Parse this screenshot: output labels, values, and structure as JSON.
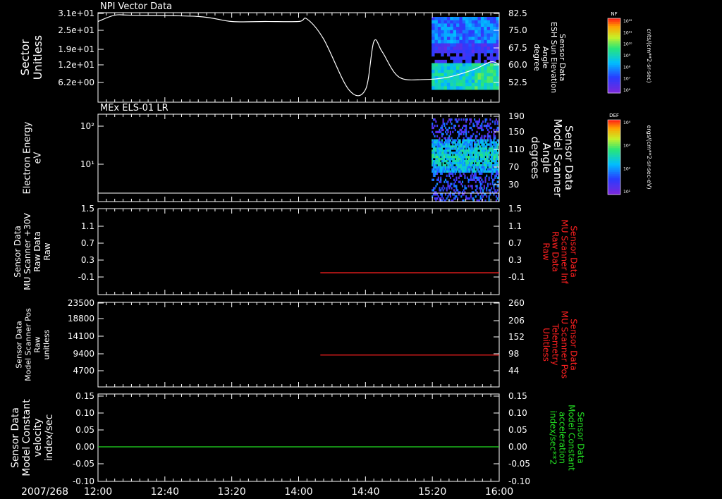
{
  "date_label": "2007/268",
  "time_ticks": [
    "12:00",
    "12:40",
    "13:20",
    "14:00",
    "14:40",
    "15:20",
    "16:00"
  ],
  "colors": {
    "white": "#ffffff",
    "red": "#ff2020",
    "green": "#22dd22"
  },
  "colorbars": [
    {
      "label": "NF",
      "units": "cnts/(cm**2-sr-sec)",
      "ticks": [
        "10¹²",
        "10¹¹",
        "10¹⁰",
        "10⁹",
        "10⁸",
        "10⁷",
        "10⁶"
      ]
    },
    {
      "label": "DEF",
      "units": "ergs/(cm**2-sr-sec-eV)",
      "ticks": [
        "10⁴",
        "10³",
        "10²",
        "10¹"
      ]
    }
  ],
  "panels": [
    {
      "title": "NPI Vector Data",
      "ylabel_left": [
        "Sector",
        "Unitless"
      ],
      "ylabel_right": [
        "Sensor Data",
        "ESH Sun Elevation",
        "Angle",
        "degree"
      ],
      "yticks_left": [
        "3.1e+01",
        "2.5e+01",
        "1.9e+01",
        "1.2e+01",
        "6.2e+00"
      ],
      "yticks_right": [
        "82.5",
        "75.0",
        "67.5",
        "60.0",
        "52.5"
      ]
    },
    {
      "title": "MEx ELS-01 LR",
      "ylabel_left": [
        "Electron Energy",
        "eV"
      ],
      "ylabel_right": [
        "Sensor Data",
        "Model Scanner",
        "Angle",
        "degrees"
      ],
      "yticks_left": [
        "10²",
        "10¹"
      ],
      "yticks_right": [
        "190",
        "150",
        "110",
        "70",
        "30"
      ]
    },
    {
      "title": "",
      "ylabel_left": [
        "Sensor Data",
        "MU Scanner +30V",
        "Raw Data",
        "Raw"
      ],
      "ylabel_right": [
        "Sensor Data",
        "MU Scanner Inf",
        "Raw Data",
        "Raw"
      ],
      "yticks_left": [
        "1.5",
        "1.1",
        "0.7",
        "0.3",
        "-0.1"
      ],
      "yticks_right": [
        "1.5",
        "1.1",
        "0.7",
        "0.3",
        "-0.1"
      ]
    },
    {
      "title": "",
      "ylabel_left": [
        "Sensor Data",
        "Model Scanner Pos",
        "Raw",
        "unitless"
      ],
      "ylabel_right": [
        "Sensor Data",
        "MU Scanner Pos",
        "Telemetry",
        "Unitless"
      ],
      "yticks_left": [
        "23500",
        "18800",
        "14100",
        "9400",
        "4700"
      ],
      "yticks_right": [
        "260",
        "206",
        "152",
        "98",
        "44"
      ]
    },
    {
      "title": "",
      "ylabel_left": [
        "Sensor Data",
        "Model Constant",
        "velocity",
        "index/sec"
      ],
      "ylabel_right": [
        "Sensor Data",
        "Model Constant",
        "acceleration",
        "index/sec**2"
      ],
      "yticks_left": [
        "0.15",
        "0.10",
        "0.05",
        "0.00",
        "-0.05",
        "-0.10"
      ],
      "yticks_right": [
        "0.15",
        "0.10",
        "0.05",
        "0.00",
        "-0.05",
        "-0.10"
      ]
    }
  ],
  "chart_data": [
    {
      "type": "line",
      "title": "NPI Vector Data",
      "series": [
        {
          "x": [
            "12:00",
            "12:10",
            "12:20",
            "13:00",
            "13:20",
            "13:40",
            "14:00",
            "14:05",
            "14:15",
            "14:30",
            "14:40",
            "14:45",
            "14:50",
            "15:00",
            "15:15",
            "15:30",
            "15:45",
            "15:55",
            "16:00"
          ],
          "values": [
            79,
            81.5,
            81.5,
            81,
            79,
            79,
            79,
            80,
            72,
            52,
            52,
            71,
            67,
            57,
            56,
            57,
            60,
            63,
            62
          ]
        }
      ],
      "ylim_right": [
        47,
        82.5
      ],
      "ylim_left": [
        0,
        31
      ]
    },
    {
      "type": "heatmap",
      "title": "MEx ELS-01 LR",
      "x_range": [
        "15:20",
        "16:00"
      ],
      "ylog": true,
      "colorbar": "DEF"
    },
    {
      "type": "line",
      "series": [
        {
          "x": [
            "14:13",
            "16:00"
          ],
          "values": [
            -0.07,
            -0.07
          ]
        }
      ],
      "ylim": [
        -0.3,
        1.5
      ]
    },
    {
      "type": "line",
      "series": [
        {
          "x": [
            "14:13",
            "16:00"
          ],
          "values": [
            9050,
            9050
          ]
        }
      ],
      "ylim": [
        0,
        23500
      ]
    },
    {
      "type": "line",
      "series": [
        {
          "x": [
            "12:00",
            "16:00"
          ],
          "values": [
            0.0,
            0.0
          ]
        }
      ],
      "ylim": [
        -0.1,
        0.15
      ]
    }
  ]
}
